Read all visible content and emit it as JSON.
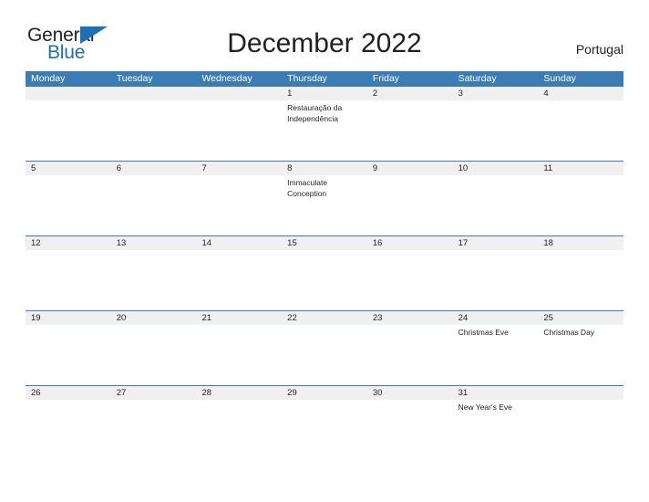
{
  "brand": {
    "name_part1": "General",
    "name_part2": "Blue",
    "accent_color": "#1d6fb8",
    "triangle_icon": "triangle-icon"
  },
  "header": {
    "title": "December 2022",
    "country": "Portugal"
  },
  "theme": {
    "header_blue": "#3c7cb4",
    "date_strip_gray": "#f0f0f0",
    "text_dark": "#231f20"
  },
  "calendar": {
    "weekdays": [
      "Monday",
      "Tuesday",
      "Wednesday",
      "Thursday",
      "Friday",
      "Saturday",
      "Sunday"
    ],
    "weeks": [
      {
        "days": [
          {
            "date": "",
            "event": ""
          },
          {
            "date": "",
            "event": ""
          },
          {
            "date": "",
            "event": ""
          },
          {
            "date": "1",
            "event": "Restauração da Independência"
          },
          {
            "date": "2",
            "event": ""
          },
          {
            "date": "3",
            "event": ""
          },
          {
            "date": "4",
            "event": ""
          }
        ]
      },
      {
        "days": [
          {
            "date": "5",
            "event": ""
          },
          {
            "date": "6",
            "event": ""
          },
          {
            "date": "7",
            "event": ""
          },
          {
            "date": "8",
            "event": "Immaculate Conception"
          },
          {
            "date": "9",
            "event": ""
          },
          {
            "date": "10",
            "event": ""
          },
          {
            "date": "11",
            "event": ""
          }
        ]
      },
      {
        "days": [
          {
            "date": "12",
            "event": ""
          },
          {
            "date": "13",
            "event": ""
          },
          {
            "date": "14",
            "event": ""
          },
          {
            "date": "15",
            "event": ""
          },
          {
            "date": "16",
            "event": ""
          },
          {
            "date": "17",
            "event": ""
          },
          {
            "date": "18",
            "event": ""
          }
        ]
      },
      {
        "days": [
          {
            "date": "19",
            "event": ""
          },
          {
            "date": "20",
            "event": ""
          },
          {
            "date": "21",
            "event": ""
          },
          {
            "date": "22",
            "event": ""
          },
          {
            "date": "23",
            "event": ""
          },
          {
            "date": "24",
            "event": "Christmas Eve"
          },
          {
            "date": "25",
            "event": "Christmas Day"
          }
        ]
      },
      {
        "days": [
          {
            "date": "26",
            "event": ""
          },
          {
            "date": "27",
            "event": ""
          },
          {
            "date": "28",
            "event": ""
          },
          {
            "date": "29",
            "event": ""
          },
          {
            "date": "30",
            "event": ""
          },
          {
            "date": "31",
            "event": "New Year's Eve"
          },
          {
            "date": "",
            "event": ""
          }
        ]
      }
    ]
  }
}
